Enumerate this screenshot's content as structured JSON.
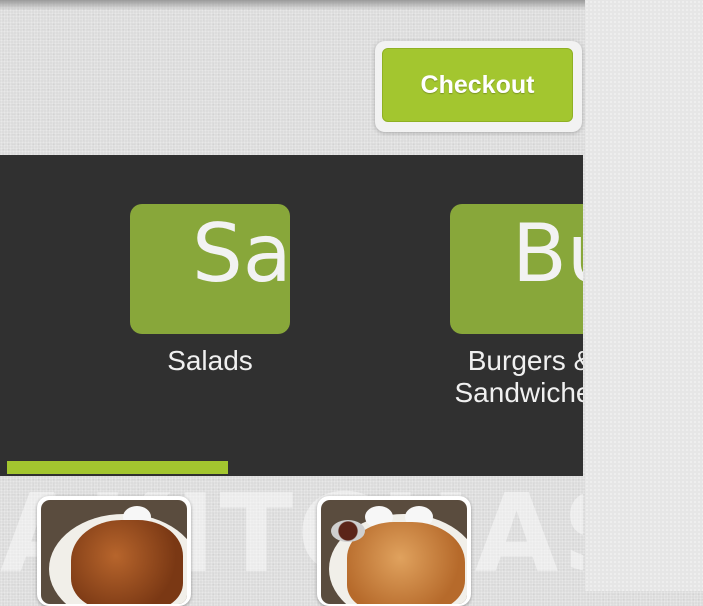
{
  "header": {
    "checkout_label": "Checkout"
  },
  "categories": [
    {
      "abbrev": "Sa",
      "label": "Salads"
    },
    {
      "abbrev": "Bu",
      "label": "Burgers &\nSandwiches"
    }
  ],
  "watermark_text": "AKITCHAS",
  "menu_items": [
    {
      "image": "fried-chicken-plate-photo"
    },
    {
      "image": "tonkatsu-plate-photo"
    }
  ],
  "colors": {
    "accent": "#a3c62f",
    "tile": "#88a73a",
    "category_bar": "#303030"
  }
}
